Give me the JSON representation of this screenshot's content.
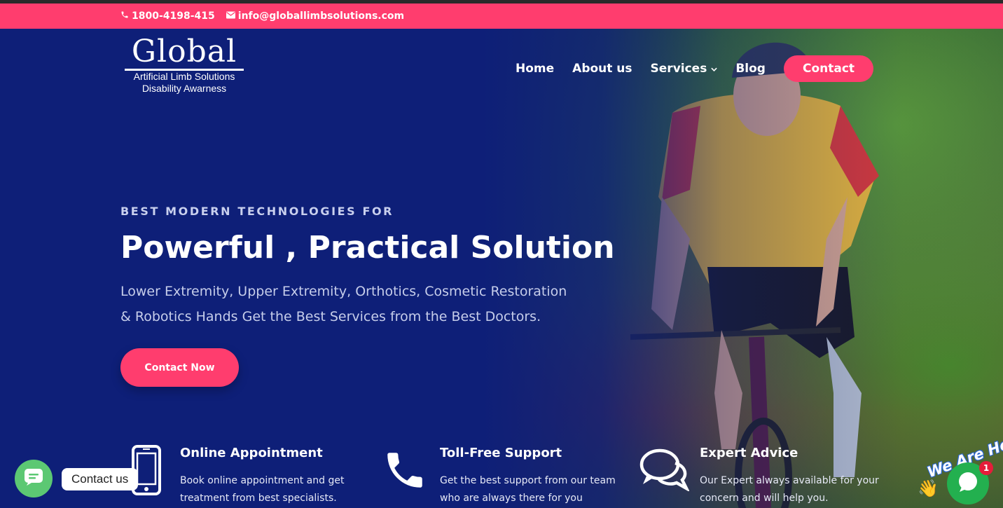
{
  "topbar": {
    "phone": "1800-4198-415",
    "email": "info@globallimbsolutions.com"
  },
  "logo": {
    "word": "Global",
    "line1": "Artificial Limb Solutions",
    "line2": "Disability Awarness"
  },
  "nav": {
    "items": [
      "Home",
      "About us",
      "Services",
      "Blog"
    ],
    "contact": "Contact"
  },
  "hero": {
    "kicker": "BEST MODERN TECHNOLOGIES FOR",
    "headline": "Powerful , Practical Solution",
    "desc_line1": "Lower Extremity, Upper Extremity, Orthotics, Cosmetic Restoration",
    "desc_line2": "& Robotics Hands Get the Best Services from the Best Doctors.",
    "cta": "Contact Now"
  },
  "features": [
    {
      "icon": "mobile-phone-icon",
      "title": "Online Appointment",
      "text": "Book online appointment and get treatment from best specialists."
    },
    {
      "icon": "phone-icon",
      "title": "Toll-Free Support",
      "text": "Get the best support from our team who are always there for you"
    },
    {
      "icon": "chat-bubbles-icon",
      "title": "Expert Advice",
      "text": "Our Expert always available for your concern and will help you."
    }
  ],
  "chat": {
    "label": "Contact us",
    "help_text": "We Are Here!",
    "badge": "1"
  },
  "colors": {
    "accent": "#ff3d6e",
    "hero_blue": "#0f1f7a",
    "chat_green": "#5cc873",
    "help_green": "#23b04f"
  }
}
